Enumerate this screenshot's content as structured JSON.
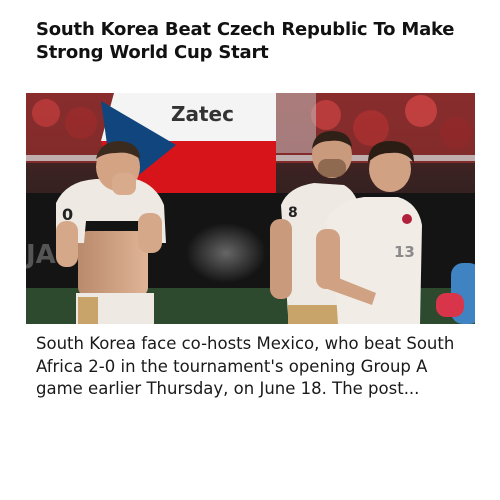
{
  "article": {
    "headline": "South Korea Beat Czech Republic To Make Strong World Cup Start",
    "snippet": "South Korea face co-hosts Mexico, who beat South Africa 2-0 in the tournament's opening Group A game earlier Thursday, on June 18. The post...",
    "image": {
      "banner_text": "Zatec",
      "left_player_number": "0",
      "center_player_number": "8",
      "right_player_number": "13",
      "jersey_color": "#eeeae3",
      "shorts_color": "#c8a46a",
      "flag_colors": [
        "#ffffff",
        "#d7141a",
        "#11457e"
      ]
    }
  }
}
